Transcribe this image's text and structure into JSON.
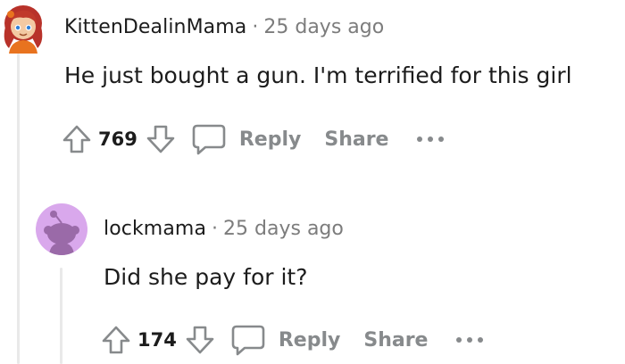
{
  "comments": [
    {
      "username": "KittenDealinMama",
      "separator": "·",
      "timestamp": "25 days ago",
      "body": "He just bought a gun. I'm terrified for this girl",
      "score": "769",
      "reply_label": "Reply",
      "share_label": "Share",
      "avatar_icon": "cartoon-girl-avatar",
      "colors": {
        "hair": "#c0392b",
        "skin": "#f3c9a2",
        "shirt": "#e8731f",
        "eyes": "#2f7fd6"
      }
    },
    {
      "username": "lockmama",
      "separator": "·",
      "timestamp": "25 days ago",
      "body": "Did she pay for it?",
      "score": "174",
      "reply_label": "Reply",
      "share_label": "Share",
      "avatar_icon": "default-snoo-avatar",
      "colors": {
        "background": "#d9a8ec",
        "snoo": "#9a6aa8"
      }
    }
  ],
  "colors": {
    "text": "#1c1c1c",
    "meta": "#7c7c7c",
    "action": "#878a8c",
    "thread_line": "#e9e9e9"
  }
}
